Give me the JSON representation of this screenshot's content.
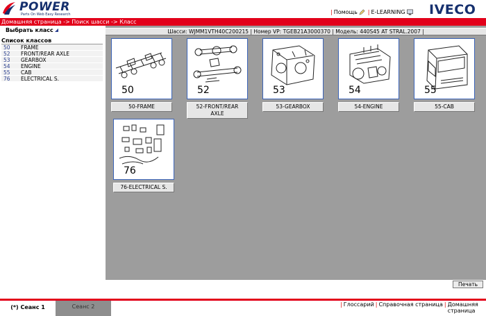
{
  "header": {
    "brand": "POWER",
    "tagline": "Parts On Web Easy Research",
    "help_label": "Помощь",
    "elearning_label": "E-LEARNING",
    "iveco": "IVECO"
  },
  "breadcrumb": "Домашняя страница -> Поиск шасси -> Класс",
  "sidebar": {
    "select_class": "Выбрать класс",
    "class_list_title": "Список классов",
    "classes": [
      {
        "code": "50",
        "name": "FRAME"
      },
      {
        "code": "52",
        "name": "FRONT/REAR AXLE"
      },
      {
        "code": "53",
        "name": "GEARBOX"
      },
      {
        "code": "54",
        "name": "ENGINE"
      },
      {
        "code": "55",
        "name": "CAB"
      },
      {
        "code": "76",
        "name": "ELECTRICAL S."
      }
    ]
  },
  "chassis_info": "Шасси: WJMM1VTH40C200215 | Номер VP: TGEB21A3000370 | Модель: 440S45 AT STRAL.2007 |",
  "tiles": [
    {
      "num": "50",
      "label": "50-FRAME",
      "icon": "frame-icon"
    },
    {
      "num": "52",
      "label": "52-FRONT/REAR AXLE",
      "icon": "axle-icon"
    },
    {
      "num": "53",
      "label": "53-GEARBOX",
      "icon": "gearbox-icon"
    },
    {
      "num": "54",
      "label": "54-ENGINE",
      "icon": "engine-icon"
    },
    {
      "num": "55",
      "label": "55-CAB",
      "icon": "cab-icon"
    },
    {
      "num": "76",
      "label": "76-ELECTRICAL S.",
      "icon": "electrical-icon"
    }
  ],
  "print_label": "Печать",
  "sessions": [
    "(*) Сеанс 1",
    "Сеанс 2"
  ],
  "bottom_links": [
    "Глоссарий",
    "Справочная страница",
    "Домашняя страница"
  ],
  "colors": {
    "accent_red": "#e2001a",
    "brand_blue": "#16306e",
    "main_bg": "#9d9d9d"
  }
}
